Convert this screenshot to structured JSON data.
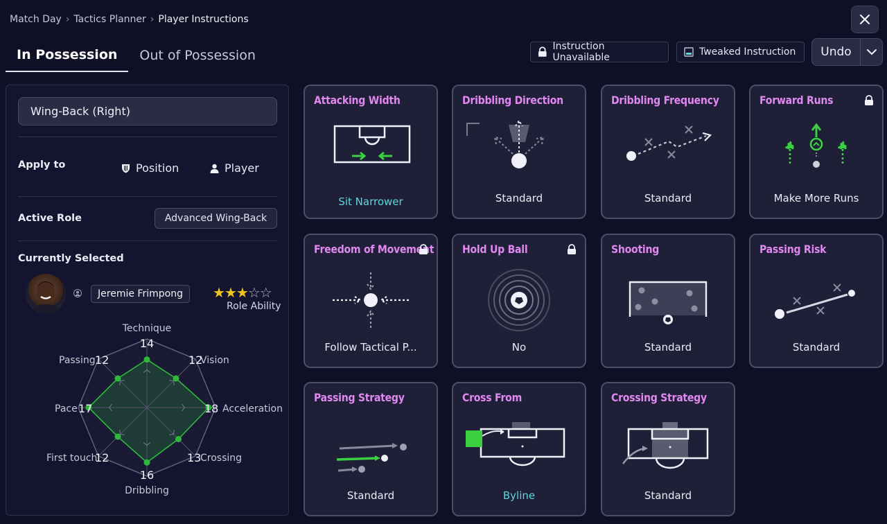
{
  "breadcrumb": [
    "Match Day",
    "Tactics Planner",
    "Player Instructions"
  ],
  "tabs": [
    "In Possession",
    "Out of Possession"
  ],
  "legend": {
    "unavailable": "Instruction Unavailable",
    "tweaked": "Tweaked Instruction"
  },
  "undo_label": "Undo",
  "left": {
    "role_select": "Wing-Back (Right)",
    "apply_to_label": "Apply to",
    "apply_position": "Position",
    "apply_player": "Player",
    "active_role_label": "Active Role",
    "active_role_value": "Advanced Wing-Back",
    "currently_selected_label": "Currently Selected",
    "player_name": "Jeremie Frimpong",
    "role_ability_label": "Role Ability",
    "role_ability_stars": 3,
    "role_ability_max": 5
  },
  "attributes": [
    {
      "name": "Technique",
      "value": 14
    },
    {
      "name": "Vision",
      "value": 12
    },
    {
      "name": "Acceleration",
      "value": 18
    },
    {
      "name": "Crossing",
      "value": 13
    },
    {
      "name": "Dribbling",
      "value": 16
    },
    {
      "name": "First touch",
      "value": 12
    },
    {
      "name": "Pace",
      "value": 17
    },
    {
      "name": "Passing",
      "value": 12
    }
  ],
  "cards": [
    {
      "title": "Attacking Width",
      "value": "Sit Narrower",
      "locked": false,
      "accent": true
    },
    {
      "title": "Dribbling Direction",
      "value": "Standard",
      "locked": false,
      "accent": false
    },
    {
      "title": "Dribbling Frequency",
      "value": "Standard",
      "locked": false,
      "accent": false
    },
    {
      "title": "Forward Runs",
      "value": "Make More Runs",
      "locked": true,
      "accent": false
    },
    {
      "title": "Freedom of Movement",
      "value": "Follow Tactical P...",
      "locked": true,
      "accent": false
    },
    {
      "title": "Hold Up Ball",
      "value": "No",
      "locked": true,
      "accent": false
    },
    {
      "title": "Shooting",
      "value": "Standard",
      "locked": false,
      "accent": false
    },
    {
      "title": "Passing Risk",
      "value": "Standard",
      "locked": false,
      "accent": false
    },
    {
      "title": "Passing Strategy",
      "value": "Standard",
      "locked": false,
      "accent": false
    },
    {
      "title": "Cross From",
      "value": "Byline",
      "locked": false,
      "accent": true
    },
    {
      "title": "Crossing Strategy",
      "value": "Standard",
      "locked": false,
      "accent": false
    }
  ],
  "colors": {
    "title": "#e088f0",
    "accent_value": "#5fd6dc",
    "radar_green": "#2fb83c"
  }
}
